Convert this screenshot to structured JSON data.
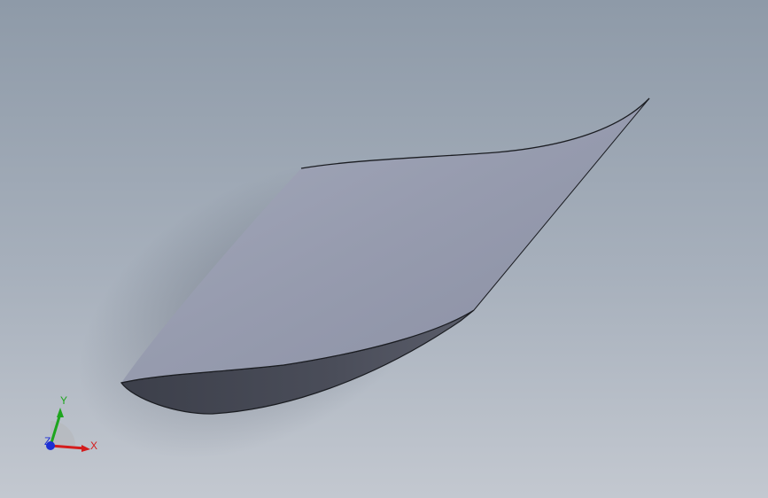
{
  "viewport": {
    "background_top": "#8e9aa8",
    "background_bottom": "#c3c8d0",
    "model": "airfoil-blade-surface",
    "surface_color": "#9aa0b3",
    "surface_shadow": "#4a4d59",
    "edge_color": "#1b1d22"
  },
  "triad": {
    "x_label": "X",
    "y_label": "Y",
    "z_label": "Z",
    "x_color": "#d41c1c",
    "y_color": "#1ea51e",
    "z_color": "#1c2fd4"
  }
}
